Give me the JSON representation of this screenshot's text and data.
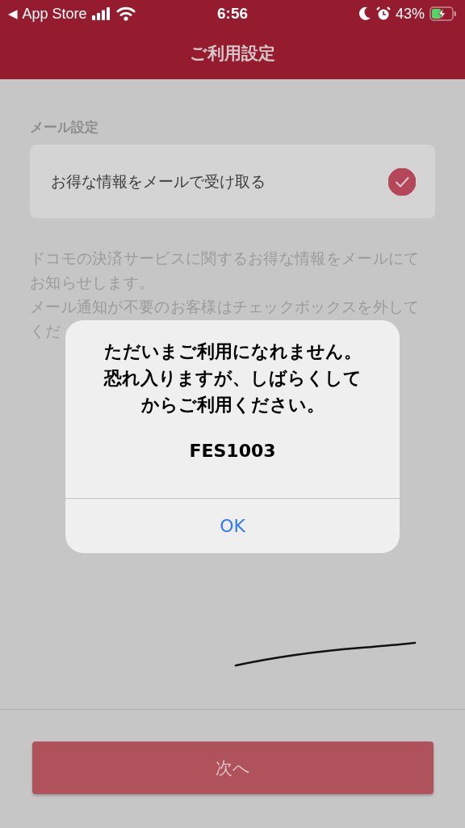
{
  "status_bar": {
    "back_arrow": "◀",
    "back_label": "App Store",
    "time": "6:56",
    "battery_percent": "43%"
  },
  "header": {
    "title": "ご利用設定"
  },
  "mail_section": {
    "label": "メール設定",
    "option": {
      "label": "お得な情報をメールで受け取る",
      "checked": true
    },
    "description": [
      {
        "lines": [
          "ドコモの決済サービスに関するお得な情報をメールにて",
          "お知らせします。"
        ]
      },
      {
        "lines": [
          "メール通知が不要のお客様はチェックボックスを外して",
          "くだ"
        ]
      }
    ]
  },
  "next_button": {
    "label": "次へ"
  },
  "alert": {
    "message": [
      "ただいまご利用になれません。",
      "恐れ入りますが、しばらくして",
      "からご利用ください。"
    ],
    "code": "FES1003",
    "buttons": [
      "OK"
    ]
  }
}
